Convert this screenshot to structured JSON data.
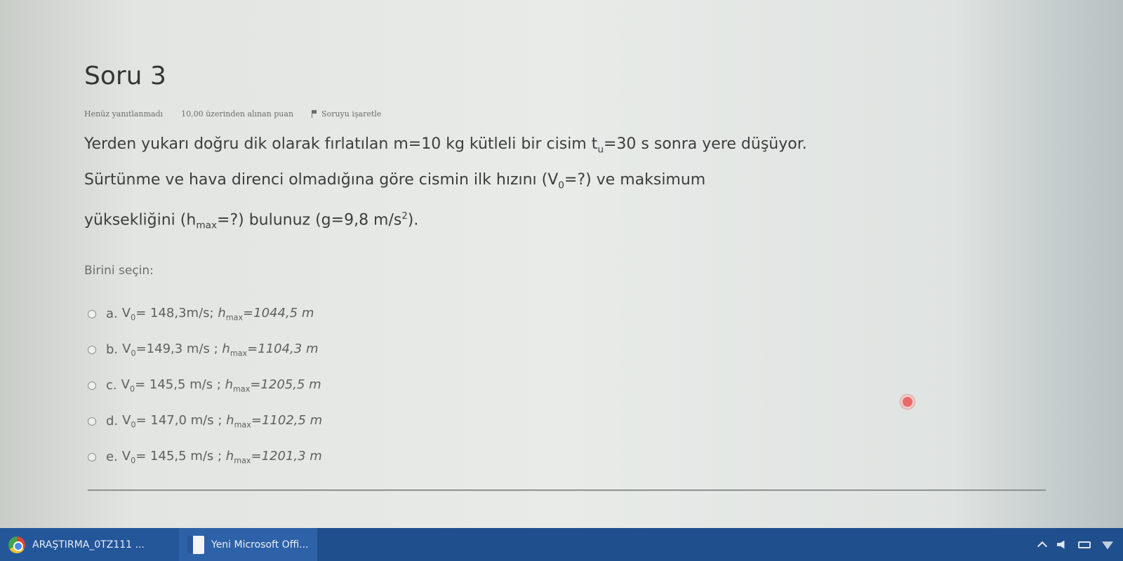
{
  "question": {
    "title": "Soru 3",
    "meta": {
      "status": "Henüz yanıtlanmadı",
      "marks": "10,00 üzerinden alınan puan",
      "flag_label": "Soruyu işaretle"
    },
    "text": {
      "line1_a": "Yerden yukarı doğru dik olarak fırlatılan m=10 kg kütleli bir cisim t",
      "line1_sub": "u",
      "line1_b": "=30 s sonra yere düşüyor.",
      "line2_a": "Sürtünme ve hava direnci olmadığına göre cismin ilk hızını (V",
      "line2_sub": "0",
      "line2_b": "=?) ve maksimum",
      "line3_a": "yüksekliğini (h",
      "line3_sub": "max",
      "line3_b": "=?) bulunuz (g=9,8 m/s",
      "line3_sup": "2",
      "line3_c": ")."
    },
    "prompt": "Birini seçin:",
    "options": [
      {
        "letter": "a.",
        "v_label": "V",
        "v_sub": "0",
        "v_val": "= 148,3m/s; ",
        "h_label": "h",
        "h_sub": "max",
        "h_val": "=1044,5 m"
      },
      {
        "letter": "b.",
        "v_label": "V",
        "v_sub": "0",
        "v_val": "=149,3 m/s ; ",
        "h_label": "h",
        "h_sub": "max",
        "h_val": "=1104,3 m"
      },
      {
        "letter": "c.",
        "v_label": "V",
        "v_sub": "0",
        "v_val": "= 145,5 m/s ; ",
        "h_label": "h",
        "h_sub": "max",
        "h_val": "=1205,5 m"
      },
      {
        "letter": "d.",
        "v_label": "V",
        "v_sub": "0",
        "v_val": "= 147,0 m/s ; ",
        "h_label": "h",
        "h_sub": "max",
        "h_val": "=1102,5 m"
      },
      {
        "letter": "e.",
        "v_label": "V",
        "v_sub": "0",
        "v_val": "= 145,5 m/s ; ",
        "h_label": "h",
        "h_sub": "max",
        "h_val": "=1201,3 m"
      }
    ]
  },
  "taskbar": {
    "items": [
      {
        "label": "ARAŞTIRMA_0TZ111 ...",
        "icon": "chrome-icon"
      },
      {
        "label": "Yeni Microsoft Offi...",
        "icon": "word-icon"
      }
    ],
    "colors": {
      "bar": "#1f4f8c",
      "active": "#2d62a8"
    }
  },
  "colors": {
    "cursor": "#e86a6a"
  }
}
